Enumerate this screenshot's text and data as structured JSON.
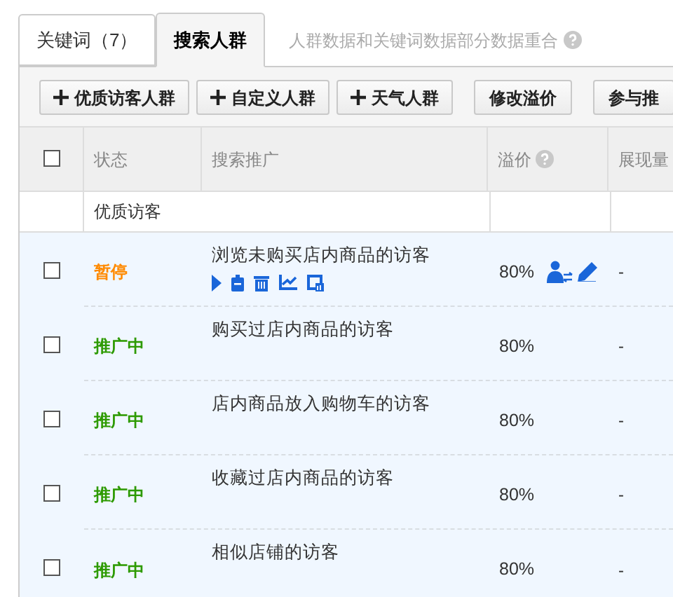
{
  "tabs": [
    {
      "label": "关键词（7）",
      "selected": false
    },
    {
      "label": "搜索人群",
      "selected": true
    }
  ],
  "tab_hint": "人群数据和关键词数据部分数据重合",
  "toolbar": [
    {
      "label": "优质访客人群",
      "kind": "add"
    },
    {
      "label": "自定义人群",
      "kind": "add"
    },
    {
      "label": "天气人群",
      "kind": "add"
    },
    {
      "label": "修改溢价",
      "kind": "plain"
    },
    {
      "label": "参与推",
      "kind": "plain"
    }
  ],
  "table": {
    "select_all": {
      "checked": false
    },
    "columns": [
      "状态",
      "搜索推广",
      "溢价",
      "展现量"
    ],
    "group": "优质访客",
    "rows": [
      {
        "checked": false,
        "status": "暂停",
        "kind": "paused",
        "name": "浏览未购买店内商品的访客",
        "premium": "80%",
        "impressions": "-",
        "hovered": true
      },
      {
        "checked": false,
        "status": "推广中",
        "kind": "active",
        "name": "购买过店内商品的访客",
        "premium": "80%",
        "impressions": "-",
        "hovered": false
      },
      {
        "checked": false,
        "status": "推广中",
        "kind": "active",
        "name": "店内商品放入购物车的访客",
        "premium": "80%",
        "impressions": "-",
        "hovered": false
      },
      {
        "checked": false,
        "status": "推广中",
        "kind": "active",
        "name": "收藏过店内商品的访客",
        "premium": "80%",
        "impressions": "-",
        "hovered": false
      },
      {
        "checked": false,
        "status": "推广中",
        "kind": "active",
        "name": "相似店铺的访客",
        "premium": "80%",
        "impressions": "-",
        "hovered": false
      }
    ]
  }
}
